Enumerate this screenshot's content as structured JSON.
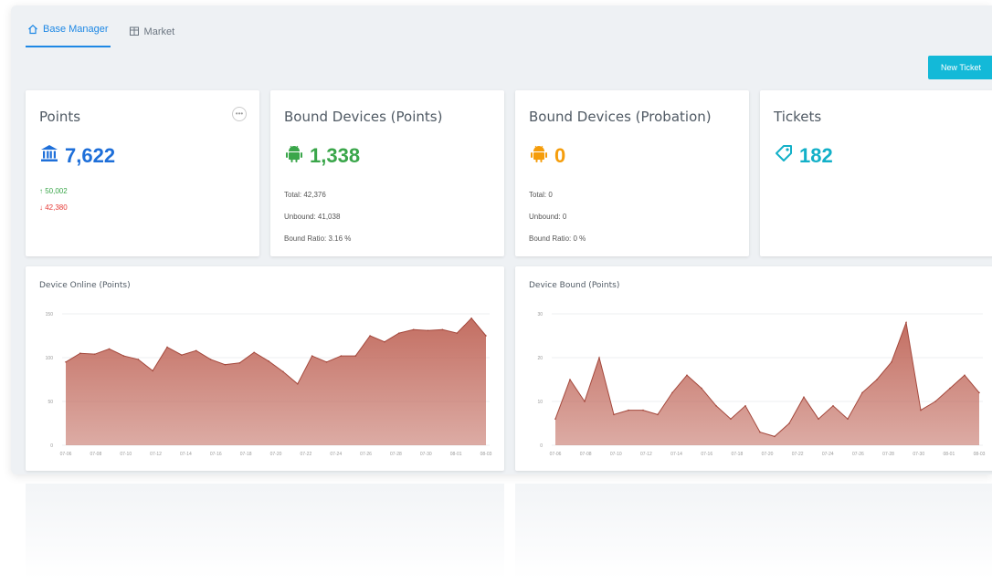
{
  "tabs": [
    {
      "label": "Base Manager",
      "icon": "home-icon",
      "active": true
    },
    {
      "label": "Market",
      "icon": "store-icon",
      "active": false
    }
  ],
  "new_ticket_label": "New Ticket",
  "cards": {
    "points": {
      "title": "Points",
      "value": "7,622",
      "icon": "bank-icon",
      "color": "#1e6fd9",
      "up": "50,002",
      "down": "42,380",
      "up_color": "#3aa64a",
      "down_color": "#e53935"
    },
    "bound_points": {
      "title": "Bound Devices (Points)",
      "value": "1,338",
      "icon": "android-icon",
      "color": "#3aa64a",
      "total": "Total: 42,376",
      "unbound": "Unbound: 41,038",
      "ratio": "Bound Ratio: 3.16 %"
    },
    "bound_probation": {
      "title": "Bound Devices (Probation)",
      "value": "0",
      "icon": "android-icon",
      "color": "#f59d0b",
      "total": "Total: 0",
      "unbound": "Unbound: 0",
      "ratio": "Bound Ratio: 0 %"
    },
    "tickets": {
      "title": "Tickets",
      "value": "182",
      "icon": "tag-icon",
      "color": "#13b0c8"
    }
  },
  "chart_data": [
    {
      "type": "area",
      "title": "Device Online (Points)",
      "ylim": [
        0,
        150
      ],
      "yticks": [
        "0",
        "50",
        "100",
        "150"
      ],
      "xticks": [
        "07-06",
        "07-08",
        "07-10",
        "07-12",
        "07-14",
        "07-16",
        "07-18",
        "07-20",
        "07-22",
        "07-24",
        "07-26",
        "07-28",
        "07-30",
        "08-01",
        "08-03"
      ],
      "values": [
        95,
        105,
        104,
        110,
        102,
        98,
        85,
        112,
        103,
        108,
        98,
        92,
        94,
        106,
        96,
        84,
        70,
        102,
        95,
        102,
        102,
        125,
        118,
        128,
        132,
        131,
        132,
        128,
        145,
        125
      ],
      "color": "#c0675a"
    },
    {
      "type": "area",
      "title": "Device Bound (Points)",
      "ylim": [
        0,
        30
      ],
      "yticks": [
        "0",
        "10",
        "20",
        "30"
      ],
      "xticks": [
        "07-06",
        "07-08",
        "07-10",
        "07-12",
        "07-14",
        "07-16",
        "07-18",
        "07-20",
        "07-22",
        "07-24",
        "07-26",
        "07-28",
        "07-30",
        "08-01",
        "08-03"
      ],
      "values": [
        6,
        15,
        10,
        20,
        7,
        8,
        8,
        7,
        12,
        16,
        13,
        9,
        6,
        9,
        3,
        2,
        5,
        11,
        6,
        9,
        6,
        12,
        15,
        19,
        28,
        8,
        10,
        13,
        16,
        12
      ],
      "color": "#c0675a"
    }
  ]
}
